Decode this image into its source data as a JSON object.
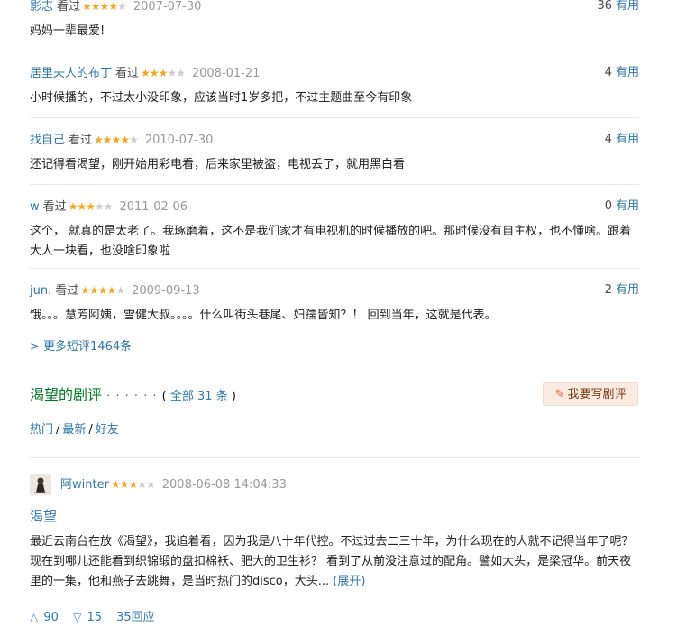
{
  "comments": [
    {
      "user": "影志",
      "watched": "看过",
      "stars": 4,
      "date": "2007-07-30",
      "useful_count": "36",
      "useful_label": "有用",
      "content": "妈妈一辈最爱!"
    },
    {
      "user": "居里夫人的布丁",
      "watched": "看过",
      "stars": 3,
      "date": "2008-01-21",
      "useful_count": "4",
      "useful_label": "有用",
      "content": "小时候播的，不过太小没印象，应该当时1岁多把，不过主题曲至今有印象"
    },
    {
      "user": "找自己",
      "watched": "看过",
      "stars": 4,
      "date": "2010-07-30",
      "useful_count": "4",
      "useful_label": "有用",
      "content": "还记得看渴望，刚开始用彩电看，后来家里被盗，电视丢了，就用黑白看"
    },
    {
      "user": "w",
      "watched": "看过",
      "stars": 3,
      "date": "2011-02-06",
      "useful_count": "0",
      "useful_label": "有用",
      "content": "这个， 就真的是太老了。我琢磨着，这不是我们家才有电视机的时候播放的吧。那时候没有自主权，也不懂啥。跟着大人一块看，也没啥印象啦"
    },
    {
      "user": "jun.",
      "watched": "看过",
      "stars": 4,
      "date": "2009-09-13",
      "useful_count": "2",
      "useful_label": "有用",
      "content": "饿。。。慧芳阿姨，雪健大叔。。。。什么叫街头巷尾、妇孺皆知？！ 回到当年，这就是代表。"
    }
  ],
  "more_comments": "> 更多短评1464条",
  "reviews_section": {
    "title": "渴望的剧评",
    "dots": "· · · · · ·",
    "open_paren": "( ",
    "all_label": "全部 31 条",
    "close_paren": " )",
    "write_button": "我要写剧评",
    "filters": [
      "热门",
      "最新",
      "好友"
    ],
    "filter_sep": "/"
  },
  "review": {
    "user": "阿winter",
    "stars": 3,
    "date": "2008-06-08 14:04:33",
    "title": "渴望",
    "body": "最近云南台在放《渴望》，我追着看，因为我是八十年代控。不过过去二三十年，为什么现在的人就不记得当年了呢？现在到哪儿还能看到织锦缎的盘扣棉袄、肥大的卫生衫？ 看到了从前没注意过的配角。譬如大头，是梁冠华。前天夜里的一集，他和燕子去跳舞，是当时热门的disco，大头...",
    "expand": "(展开)",
    "up_votes": "90",
    "down_votes": "15",
    "replies": "35回应"
  },
  "colors": {
    "link": "#3377aa",
    "star": "#f5a623",
    "green_title": "#007722",
    "button_bg": "#fbeae0"
  }
}
